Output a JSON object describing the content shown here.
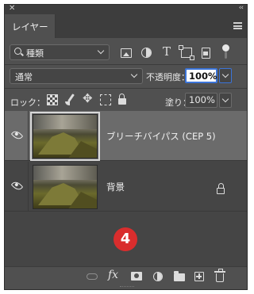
{
  "panel": {
    "tab_label": "レイヤー",
    "close_glyph": "✕",
    "collapse_glyph": "‹‹"
  },
  "filter": {
    "kind_label": "種類",
    "icons": [
      "image-filter-icon",
      "adjustment-filter-icon",
      "type-filter-icon",
      "shape-filter-icon",
      "smart-object-filter-icon"
    ],
    "filter_toggle": "on"
  },
  "blend": {
    "mode_label": "通常",
    "opacity_label": "不透明度：",
    "opacity_value": "100%"
  },
  "lock": {
    "label": "ロック：",
    "icons": [
      "lock-transparent-icon",
      "lock-image-icon",
      "lock-position-icon",
      "lock-artboard-icon",
      "lock-all-icon"
    ],
    "fill_label": "塗り：",
    "fill_value": "100%"
  },
  "layers": [
    {
      "name": "ブリーチバイパス (CEP 5)",
      "visible": true,
      "selected": true,
      "locked": false
    },
    {
      "name": "背景",
      "visible": true,
      "selected": false,
      "locked": true
    }
  ],
  "step_badge": "4",
  "bottom_icons": [
    "link-layers-icon",
    "fx-icon",
    "add-mask-icon",
    "adjustment-layer-icon",
    "new-group-icon",
    "new-layer-icon",
    "delete-layer-icon"
  ],
  "bottom": {
    "fx_label": "fx"
  },
  "colors": {
    "selected_row": "#6b6b6b",
    "focus_blue": "#3b74d8",
    "badge_red": "#d92d2d"
  }
}
